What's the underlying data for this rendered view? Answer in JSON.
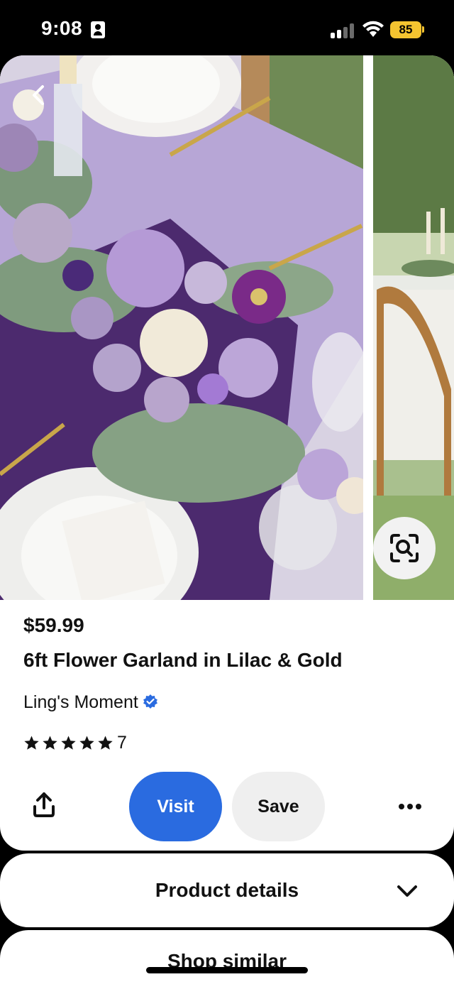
{
  "status_bar": {
    "time": "9:08",
    "battery": "85"
  },
  "product": {
    "price": "$59.99",
    "title": "6ft Flower Garland in Lilac & Gold",
    "seller": "Ling's Moment",
    "rating": 5,
    "rating_count": "7"
  },
  "actions": {
    "visit_label": "Visit",
    "save_label": "Save"
  },
  "sections": {
    "product_details": "Product details",
    "shop_similar": "Shop similar"
  },
  "colors": {
    "visit_blue": "#2a6be0",
    "verified_blue": "#2a6be0",
    "battery_yellow": "#f4c430"
  },
  "icons": [
    "back-chevron-icon",
    "visual-search-icon",
    "share-icon",
    "more-options-icon",
    "chevron-down-icon",
    "verified-badge-icon",
    "star-icon"
  ]
}
